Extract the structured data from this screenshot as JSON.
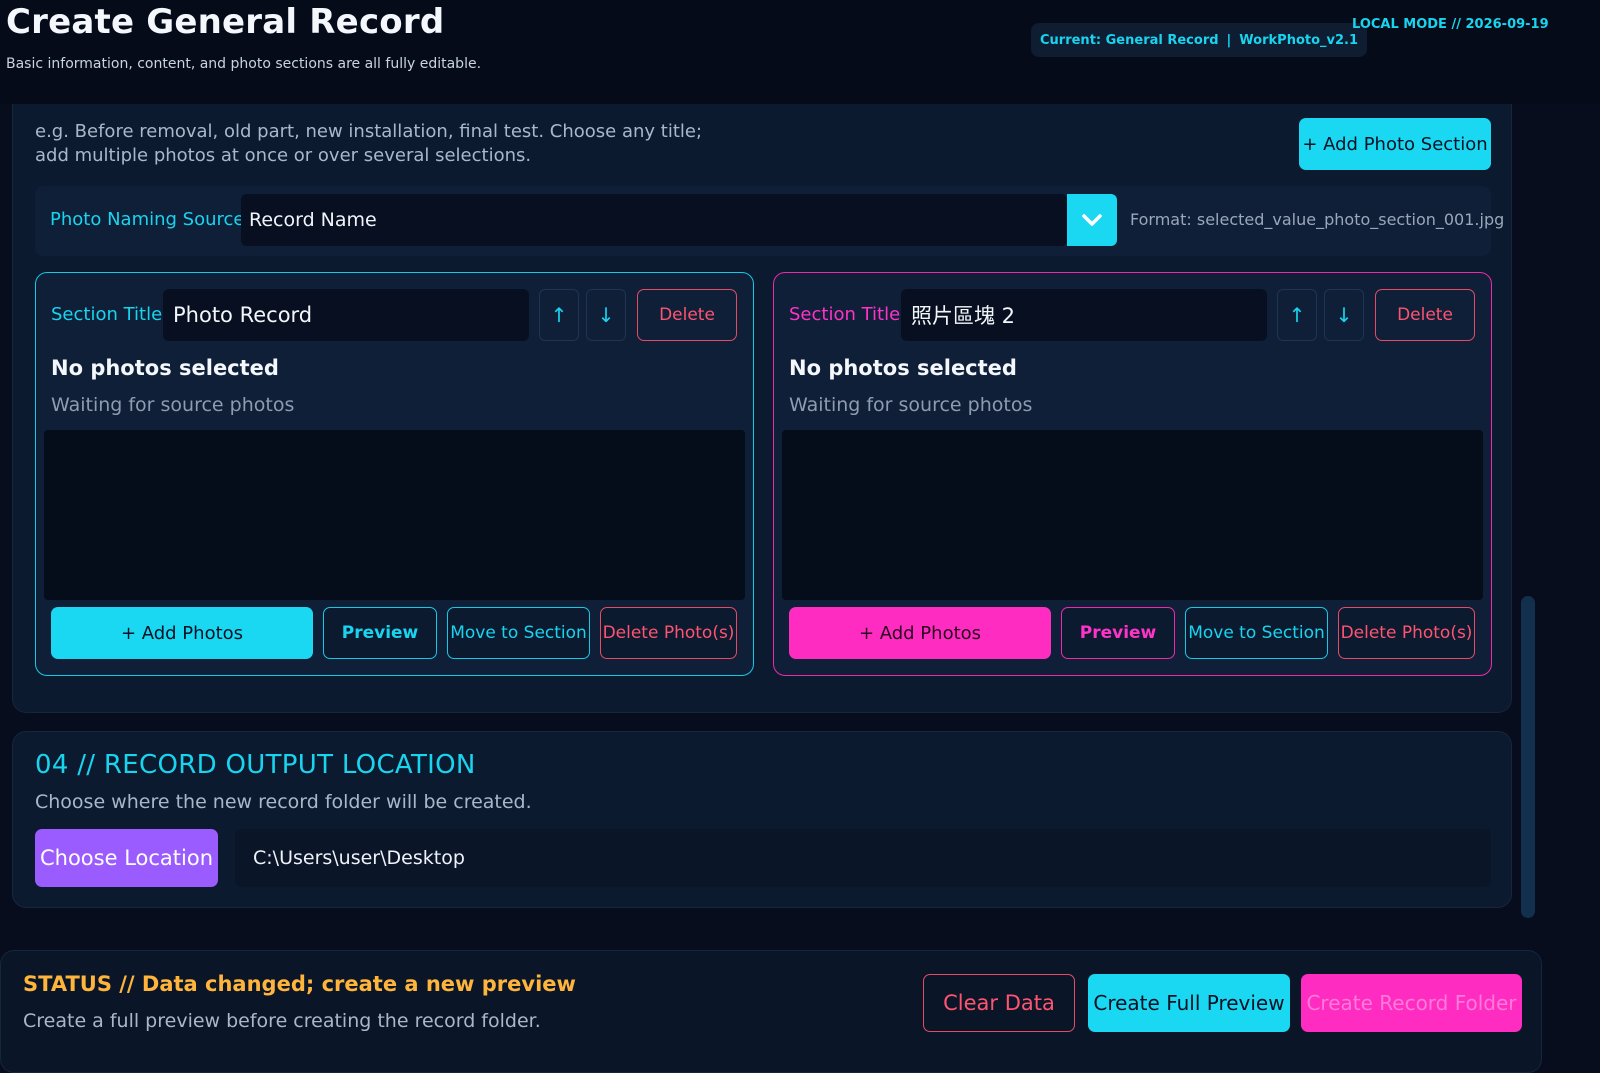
{
  "header": {
    "title": "Create General Record",
    "subtitle": "Basic information, content, and photo sections are all fully editable.",
    "current_label": "Current: General Record",
    "separator": "|",
    "version": "WorkPhoto_v2.1",
    "mode": "LOCAL MODE  //  2026-09-19"
  },
  "photos": {
    "hint": "e.g. Before removal, old part, new installation, final test. Choose any title; add multiple photos at once or over several selections.",
    "add_section_label": "+ Add Photo Section",
    "naming": {
      "label": "Photo Naming Source",
      "selected": "Record Name",
      "format": "Format: selected_value_photo_section_001.jpg"
    },
    "sections": [
      {
        "title_label": "Section Title",
        "title_value": "Photo Record",
        "up": "↑",
        "down": "↓",
        "delete": "Delete",
        "empty_title": "No photos selected",
        "empty_sub": "Waiting for source photos",
        "add_photos": "+ Add Photos",
        "preview": "Preview",
        "move": "Move to Section",
        "delete_photos": "Delete Photo(s)"
      },
      {
        "title_label": "Section Title",
        "title_value": "照片區塊 2",
        "up": "↑",
        "down": "↓",
        "delete": "Delete",
        "empty_title": "No photos selected",
        "empty_sub": "Waiting for source photos",
        "add_photos": "+ Add Photos",
        "preview": "Preview",
        "move": "Move to Section",
        "delete_photos": "Delete Photo(s)"
      }
    ]
  },
  "output": {
    "title": "04 // RECORD OUTPUT LOCATION",
    "description": "Choose where the new record folder will be created.",
    "choose_label": "Choose Location",
    "path": "C:\\Users\\user\\Desktop"
  },
  "status": {
    "title": "STATUS // Data changed; create a new preview",
    "description": "Create a full preview before creating the record folder.",
    "clear_label": "Clear Data",
    "preview_label": "Create Full Preview",
    "create_label": "Create Record Folder"
  },
  "colors": {
    "accent_cyan": "#1ad8f2",
    "accent_pink": "#ff2cc2",
    "accent_purple": "#9b5cff",
    "danger": "#ff5470",
    "warning": "#ffb43b"
  }
}
